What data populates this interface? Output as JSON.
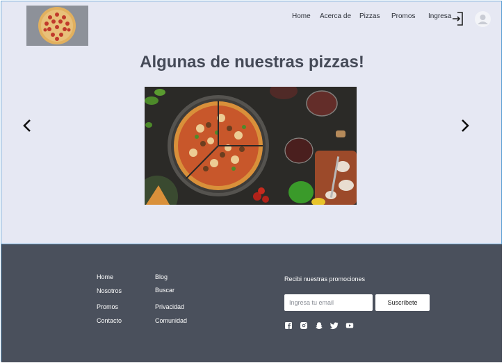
{
  "header": {
    "logo_icon": "pizza-logo",
    "nav": [
      "Home",
      "Acerca de",
      "Pizzas",
      "Promos"
    ],
    "login_label": "Ingresa",
    "login_icon": "login-icon",
    "avatar_icon": "user-avatar-icon"
  },
  "hero": {
    "title": "Algunas de nuestras pizzas!",
    "prev_icon": "chevron-left-icon",
    "next_icon": "chevron-right-icon",
    "image": "pizza-photo"
  },
  "footer": {
    "links_col1": [
      "Home",
      "Nosotros",
      "Promos",
      "Contacto"
    ],
    "links_col2": [
      "Blog",
      "Buscar",
      "Privacidad",
      "Comunidad"
    ],
    "newsletter_title": "Recibi nuestras promociones",
    "email_placeholder": "Ingresa tu email",
    "subscribe_label": "Suscríbete",
    "social_icons": [
      "facebook-icon",
      "instagram-icon",
      "snapchat-icon",
      "twitter-icon",
      "youtube-icon"
    ]
  },
  "colors": {
    "page_bg": "#e6e8f3",
    "footer_bg": "#4a505c",
    "title": "#454a57",
    "border": "#6aa8d8"
  }
}
